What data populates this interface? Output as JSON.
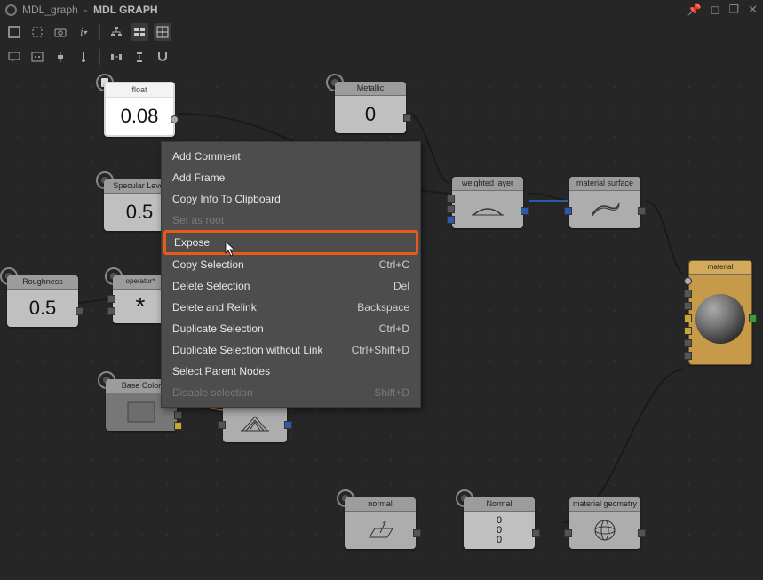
{
  "window": {
    "title_prefix": "MDL_graph",
    "title_suffix": "MDL GRAPH"
  },
  "nodes": {
    "float": {
      "label": "float",
      "value": "0.08"
    },
    "metallic": {
      "label": "Metallic",
      "value": "0"
    },
    "specular": {
      "label": "Specular Level",
      "value": "0.5"
    },
    "roughness": {
      "label": "Roughness",
      "value": "0.5"
    },
    "operator": {
      "label": "operator*",
      "glyph": "*"
    },
    "unnamed1": {
      "label": ""
    },
    "basecolor": {
      "label": "Base Color"
    },
    "unnamed2": {
      "label": ""
    },
    "weighted": {
      "label": "weighted layer"
    },
    "surface": {
      "label": "material surface"
    },
    "normal": {
      "label": "normal"
    },
    "normal2": {
      "label": "Normal",
      "stack": [
        "0",
        "0",
        "0"
      ]
    },
    "geometry": {
      "label": "material geometry"
    },
    "material": {
      "label": "material"
    }
  },
  "context_menu": [
    {
      "label": "Add Comment",
      "shortcut": "",
      "enabled": true
    },
    {
      "label": "Add Frame",
      "shortcut": "",
      "enabled": true
    },
    {
      "label": "Copy Info To Clipboard",
      "shortcut": "",
      "enabled": true
    },
    {
      "label": "Set as root",
      "shortcut": "",
      "enabled": false
    },
    {
      "label": "Expose",
      "shortcut": "",
      "enabled": true,
      "highlight": true
    },
    {
      "label": "Copy Selection",
      "shortcut": "Ctrl+C",
      "enabled": true
    },
    {
      "label": "Delete Selection",
      "shortcut": "Del",
      "enabled": true
    },
    {
      "label": "Delete and Relink",
      "shortcut": "Backspace",
      "enabled": true
    },
    {
      "label": "Duplicate Selection",
      "shortcut": "Ctrl+D",
      "enabled": true
    },
    {
      "label": "Duplicate Selection without Link",
      "shortcut": "Ctrl+Shift+D",
      "enabled": true
    },
    {
      "label": "Select Parent Nodes",
      "shortcut": "",
      "enabled": true
    },
    {
      "label": "Disable selection",
      "shortcut": "Shift+D",
      "enabled": false
    }
  ],
  "icons": {
    "pin": "📌",
    "maximize": "◻",
    "restore": "❐",
    "close": "✕"
  }
}
